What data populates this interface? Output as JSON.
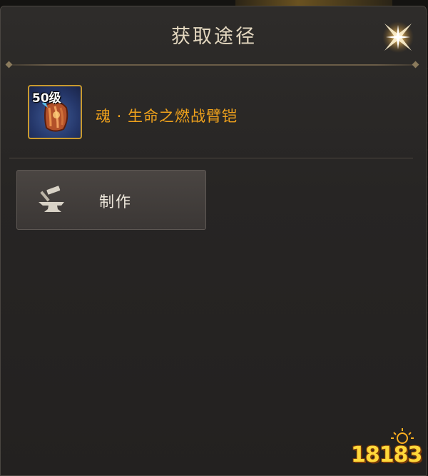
{
  "dialog": {
    "title": "获取途径",
    "close_icon": "close-sparkle-icon"
  },
  "item": {
    "level_badge": "50级",
    "name": "魂 · 生命之燃战臂铠",
    "icon": "armguard-item-icon",
    "name_color": "#f0a21c",
    "border_color": "#c99a2e"
  },
  "sources": [
    {
      "label": "制作",
      "icon": "anvil-hammer-icon"
    }
  ],
  "watermark": {
    "text": "18183"
  }
}
